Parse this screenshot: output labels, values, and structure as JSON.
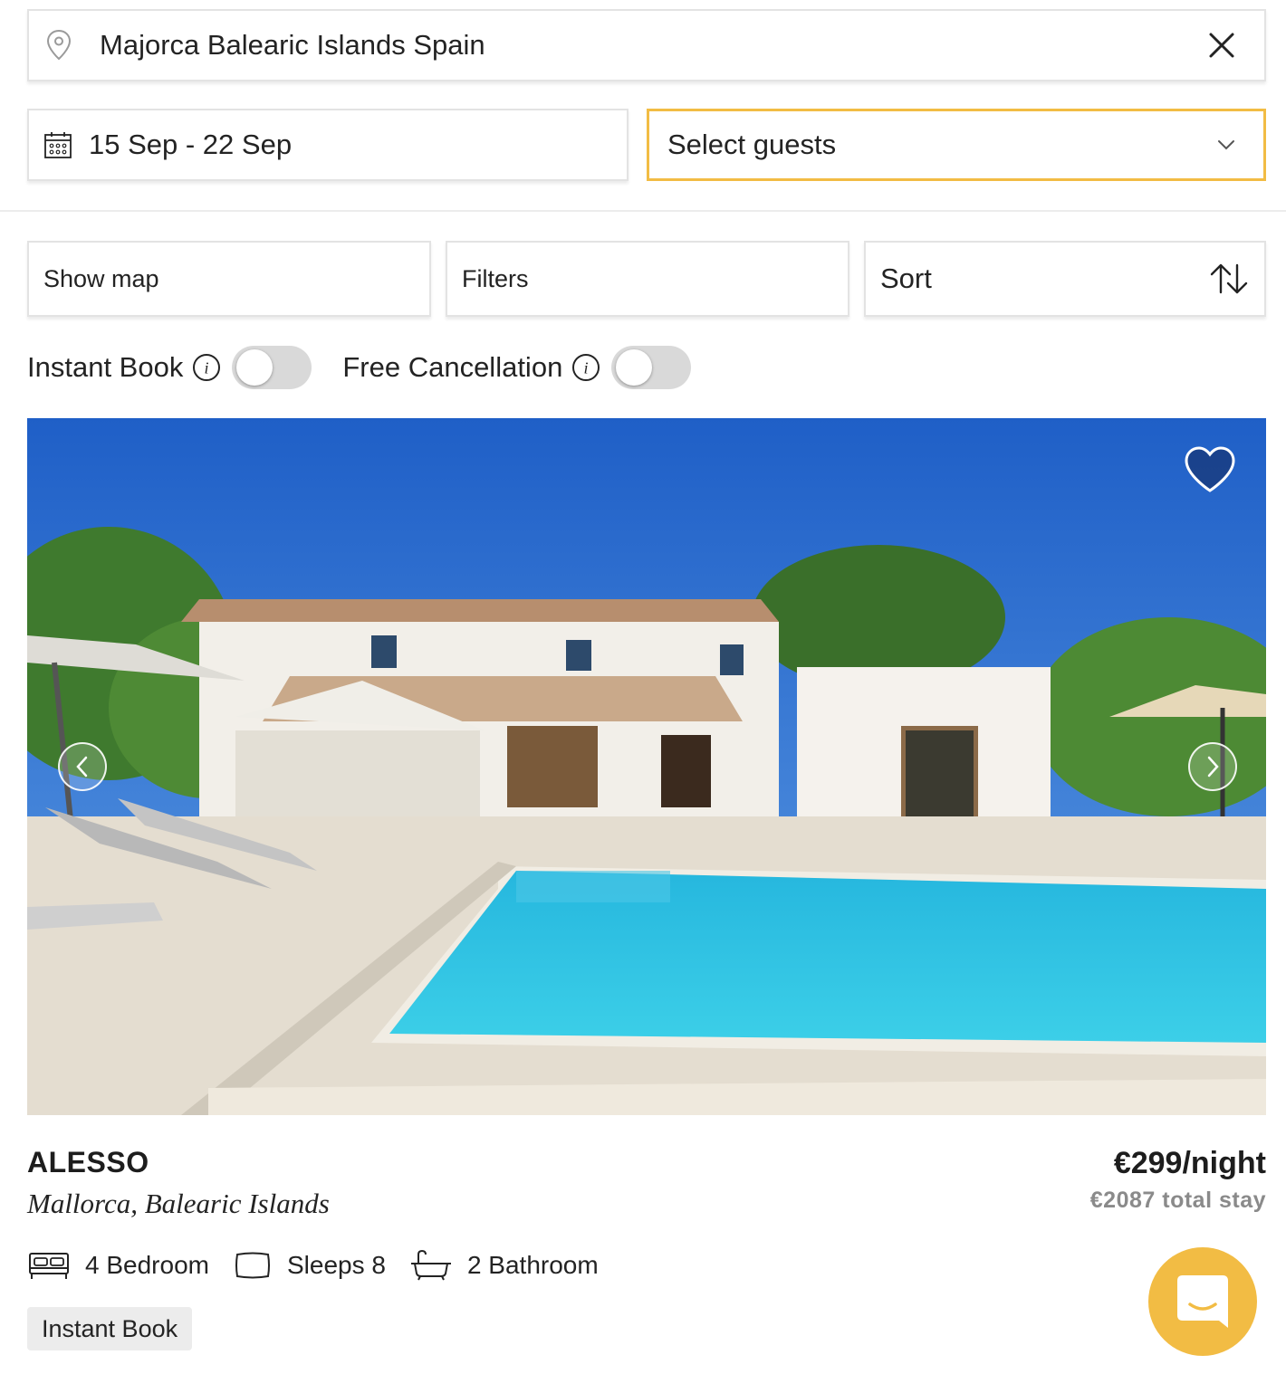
{
  "search": {
    "location_value": "Majorca Balearic Islands Spain",
    "dates_value": "15 Sep - 22 Sep",
    "guests_placeholder": "Select guests"
  },
  "toolbar": {
    "show_map_label": "Show map",
    "filters_label": "Filters",
    "sort_label": "Sort"
  },
  "toggles": {
    "instant_book_label": "Instant Book",
    "instant_book_on": false,
    "free_cancellation_label": "Free Cancellation",
    "free_cancellation_on": false
  },
  "listing": {
    "name": "ALESSO",
    "location": "Mallorca, Balearic Islands",
    "price_per_night": "€299/night",
    "total_stay": "€2087 total stay",
    "amenities": {
      "bedrooms": "4 Bedroom",
      "sleeps": "Sleeps 8",
      "bathrooms": "2 Bathroom"
    },
    "badge": "Instant Book"
  },
  "icons": [
    "location-pin-icon",
    "close-icon",
    "calendar-icon",
    "chevron-down-icon",
    "sort-arrows-icon",
    "info-icon",
    "heart-icon",
    "chevron-left-icon",
    "chevron-right-icon",
    "bed-icon",
    "sleeps-icon",
    "bathtub-icon",
    "chat-icon"
  ],
  "colors": {
    "accent": "#f2bc44",
    "text": "#232323",
    "muted": "#8a8a8a",
    "border": "#e3e3e3",
    "badge_bg": "#ececec"
  }
}
